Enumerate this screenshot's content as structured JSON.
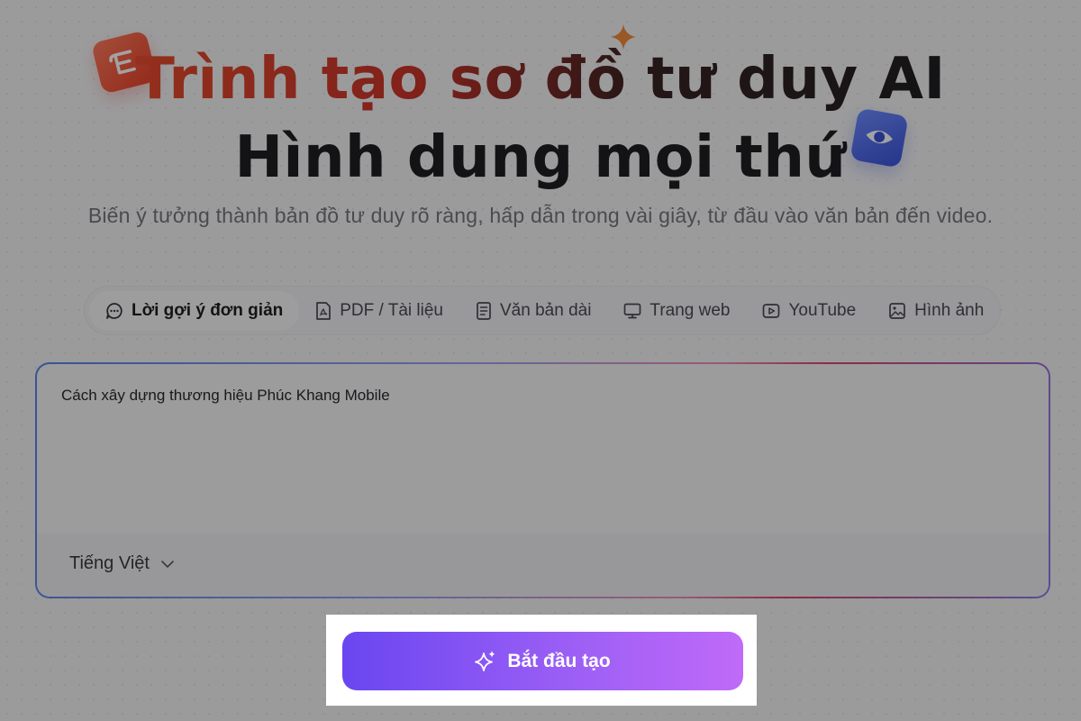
{
  "hero": {
    "title_line1": "Trình tạo sơ đồ tư duy AI",
    "title_line2": "Hình dung mọi thứ",
    "subtitle": "Biến ý tưởng thành bản đồ tư duy rõ ràng, hấp dẫn trong vài giây, từ đầu vào văn bản đến video."
  },
  "tabs": [
    {
      "label": "Lời gợi ý đơn giản",
      "icon": "chat-bubble-icon",
      "active": true
    },
    {
      "label": "PDF / Tài liệu",
      "icon": "pdf-icon",
      "active": false
    },
    {
      "label": "Văn bản dài",
      "icon": "document-icon",
      "active": false
    },
    {
      "label": "Trang web",
      "icon": "monitor-icon",
      "active": false
    },
    {
      "label": "YouTube",
      "icon": "play-icon",
      "active": false
    },
    {
      "label": "Hình ảnh",
      "icon": "image-icon",
      "active": false
    }
  ],
  "prompt": {
    "value": "Cách xây dựng thương hiệu Phúc Khang Mobile",
    "language": "Tiếng Việt"
  },
  "cta": {
    "label": "Bắt đầu tạo",
    "icon": "sparkle-icon"
  },
  "colors": {
    "accent_start": "#6a46f0",
    "accent_end": "#c06af8",
    "title_red": "#e54b2e",
    "note_icon": "#e8412a",
    "eye_icon": "#3a52d9",
    "star": "#f08a3c"
  }
}
